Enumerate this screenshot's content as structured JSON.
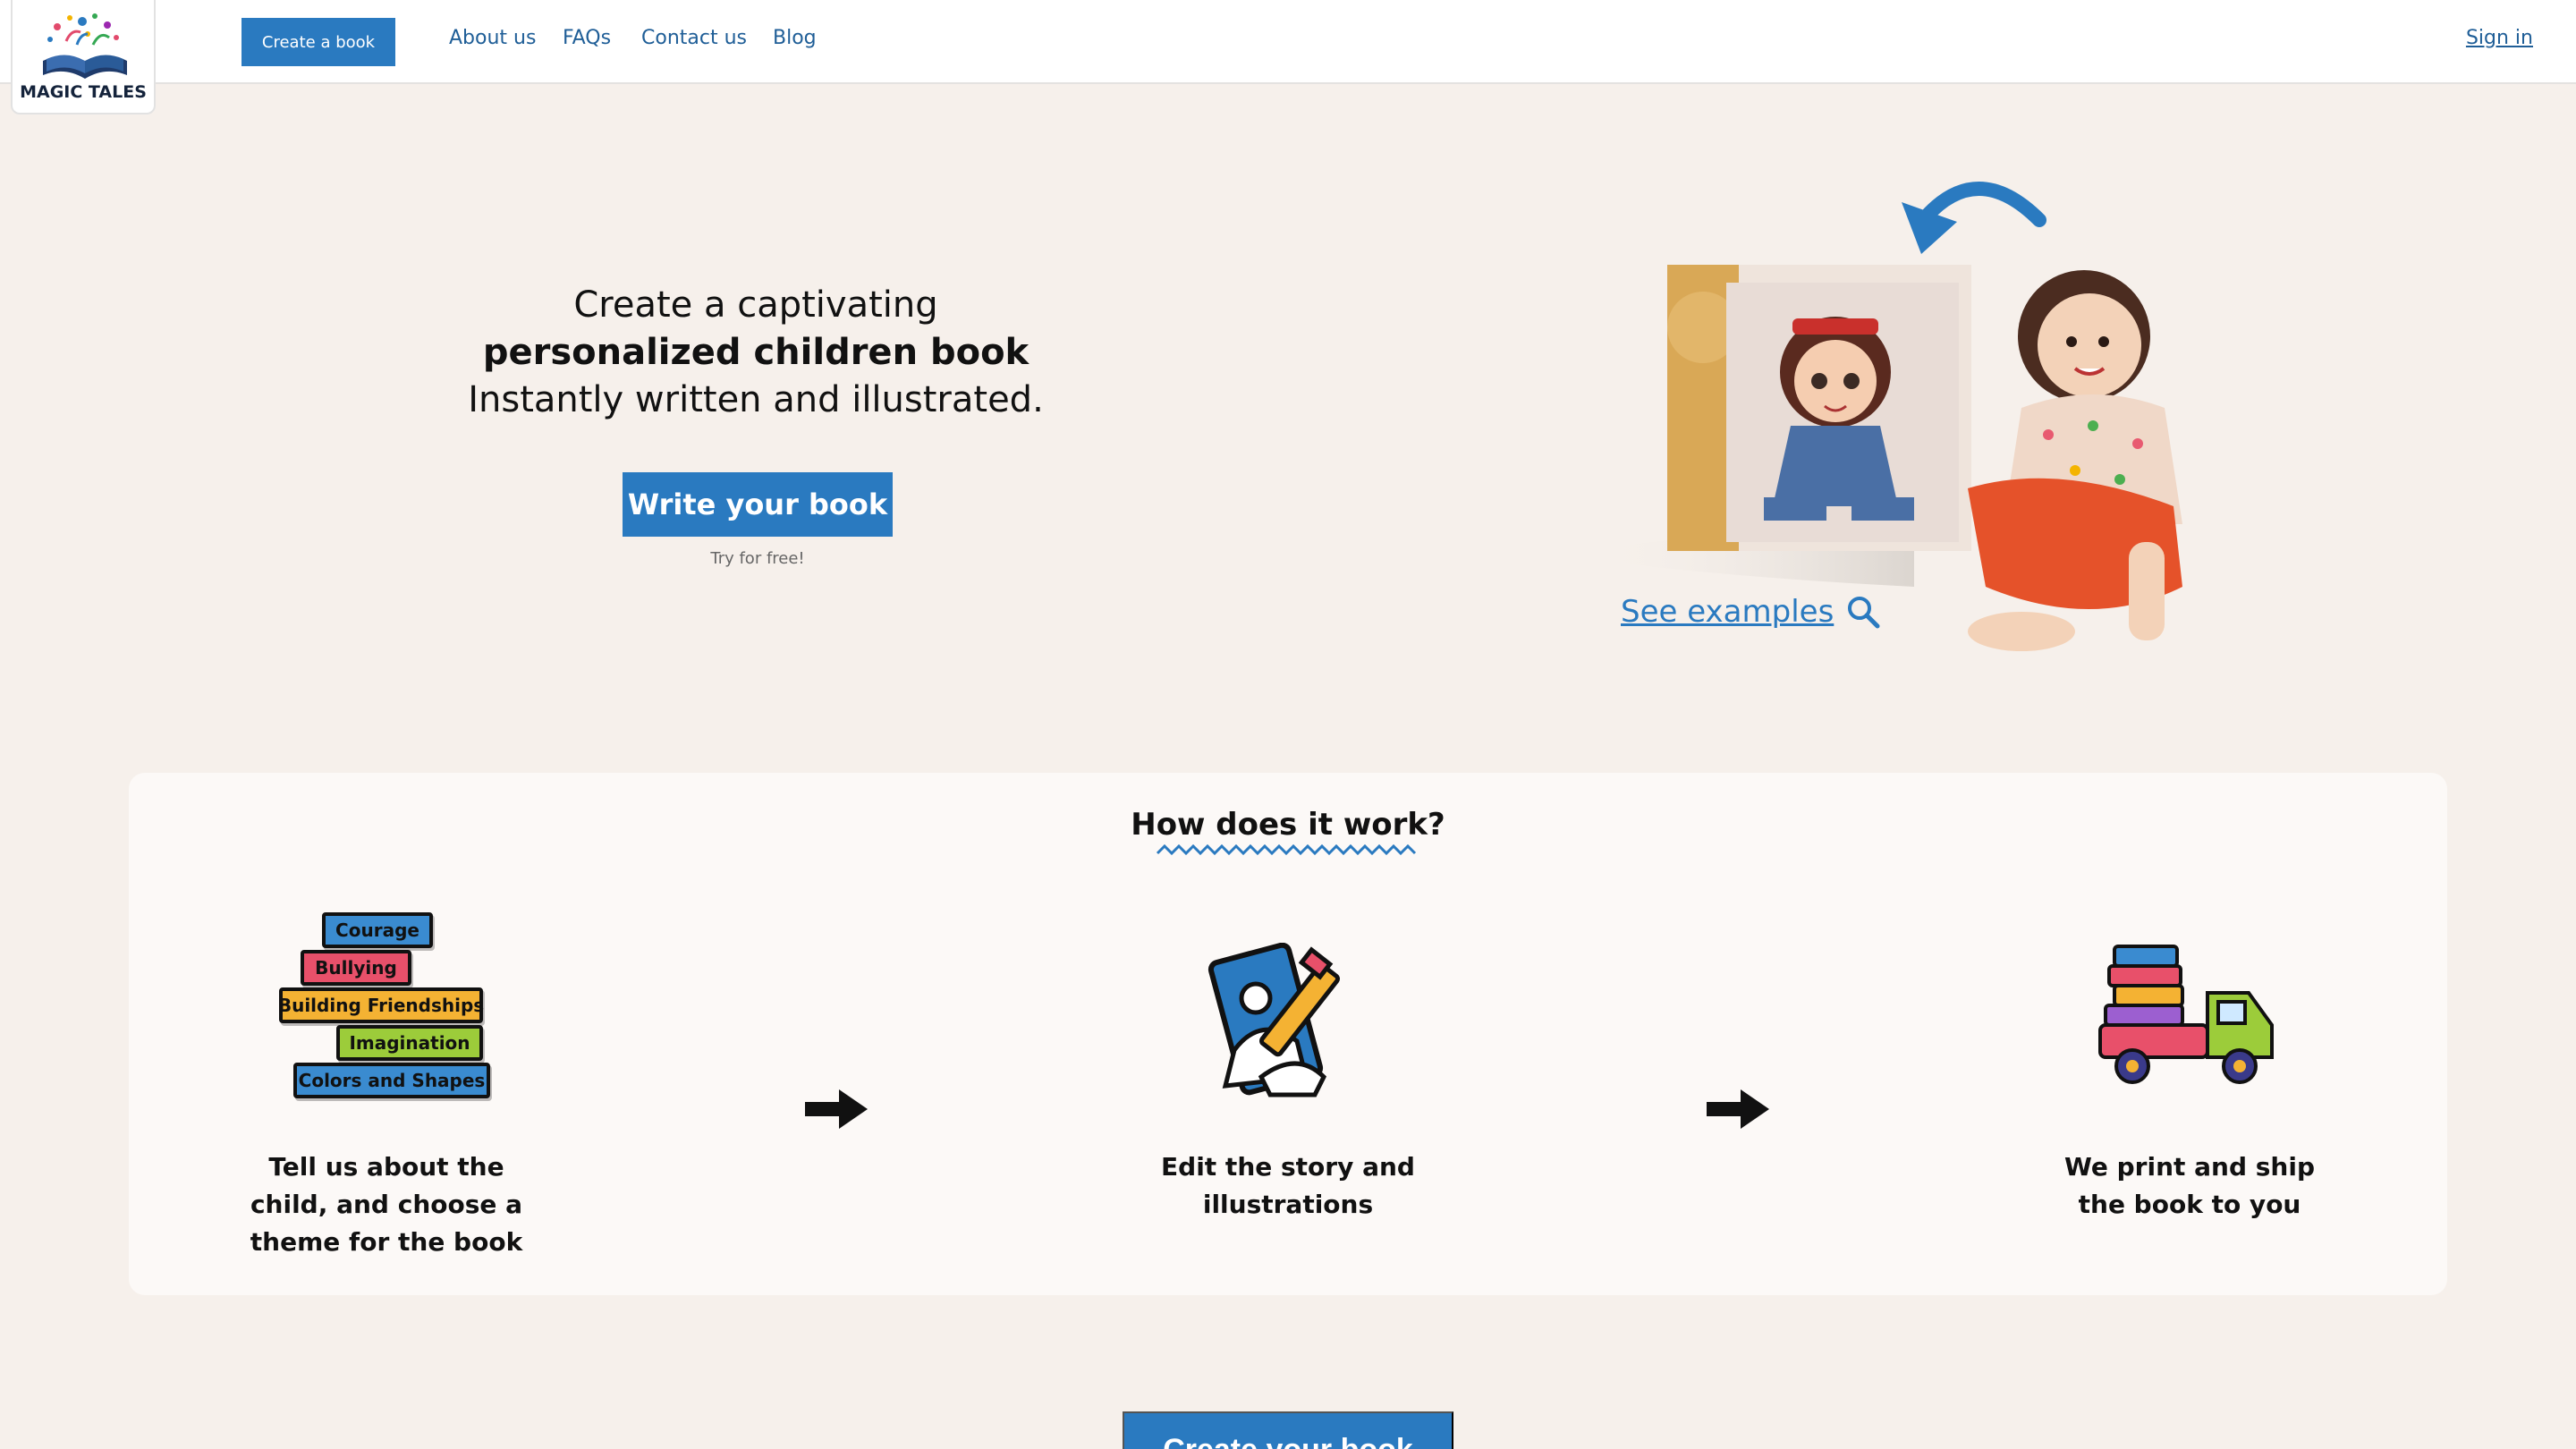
{
  "header": {
    "logo_text": "MAGIC TALES",
    "create_button": "Create a book",
    "nav": [
      "About us",
      "FAQs",
      "Contact us",
      "Blog"
    ],
    "signin": "Sign in"
  },
  "hero": {
    "line1": "Create a captivating",
    "line2": "personalized children book",
    "line3": "Instantly written and illustrated.",
    "cta": "Write your book",
    "subtext": "Try for free!",
    "see_examples": "See examples"
  },
  "how": {
    "title": "How does it work?",
    "themes": [
      "Courage",
      "Bullying",
      "Building Friendships",
      "Imagination",
      "Colors and Shapes"
    ],
    "steps": [
      "Tell us about the child, and choose a theme for the book",
      "Edit the story and illustrations",
      "We print and ship the book to you"
    ]
  },
  "bottom_cta": "Create your book",
  "colors": {
    "accent": "#2a7ac0",
    "background": "#f6f0eb",
    "card": "#fcf9f7"
  }
}
